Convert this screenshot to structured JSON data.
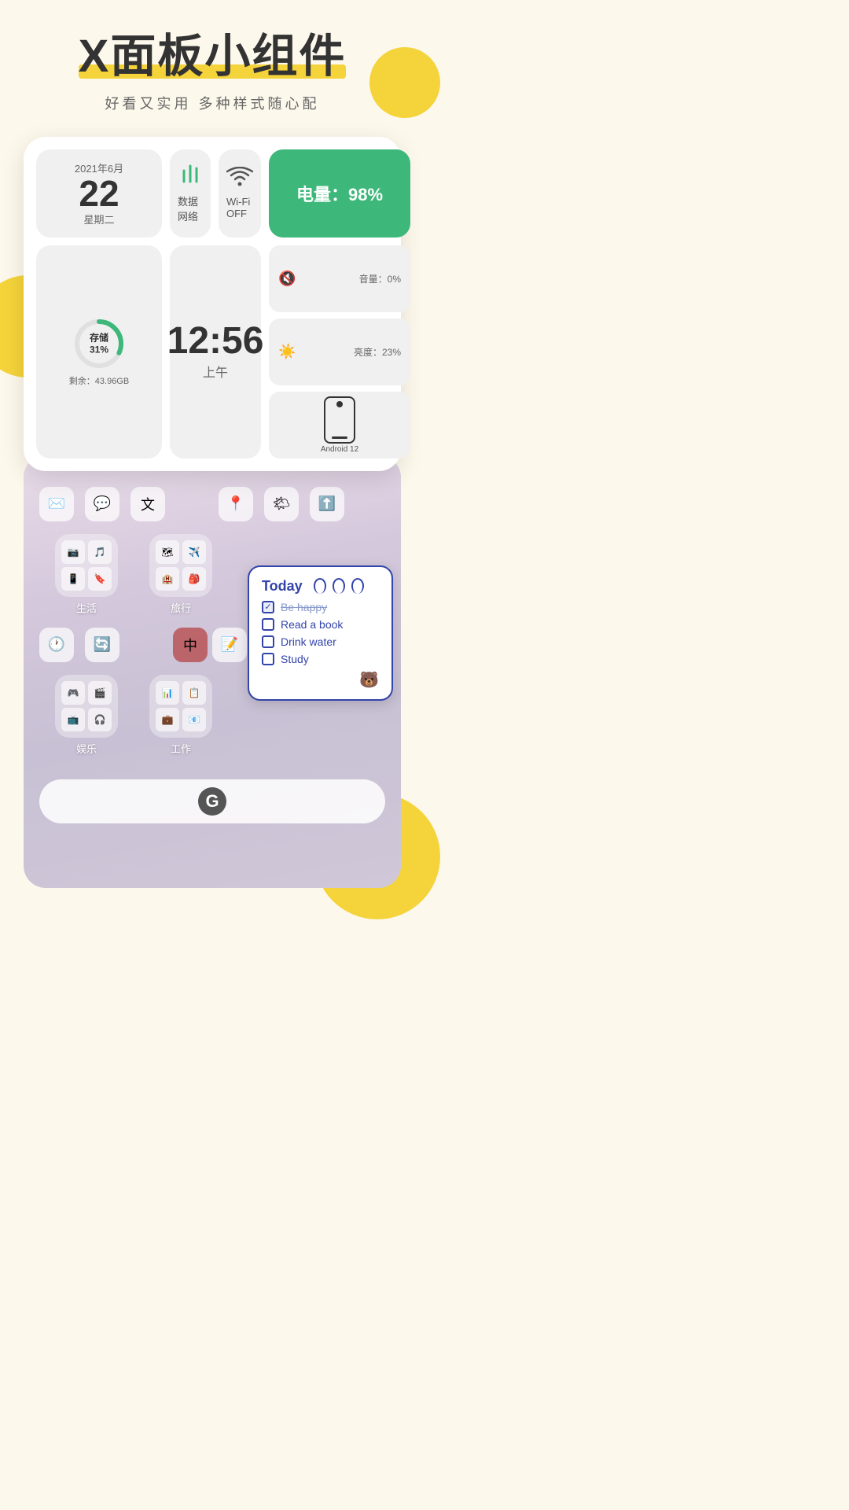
{
  "header": {
    "title": "X面板小组件",
    "subtitle": "好看又实用  多种样式随心配"
  },
  "widget": {
    "date": {
      "year_month": "2021年6月",
      "day": "22",
      "weekday": "星期二"
    },
    "network": {
      "label": "数据网络"
    },
    "wifi": {
      "label": "Wi-Fi OFF"
    },
    "battery": {
      "text": "电量：98%"
    },
    "storage": {
      "label": "存储",
      "percent": "31%",
      "remaining": "剩余：43.96GB"
    },
    "clock": {
      "time": "12:56",
      "ampm": "上午"
    },
    "volume": {
      "label": "音量：0%"
    },
    "brightness": {
      "label": "亮度：23%"
    },
    "phone_model": {
      "label": "Android 12"
    }
  },
  "phone_ui": {
    "folders": [
      {
        "label": "生活"
      },
      {
        "label": "旅行"
      },
      {
        "label": "娱乐"
      },
      {
        "label": "工作"
      }
    ]
  },
  "today_widget": {
    "title": "Today",
    "items": [
      {
        "text": "Be happy",
        "checked": true,
        "strikethrough": true
      },
      {
        "text": "Read a book",
        "checked": false,
        "strikethrough": false
      },
      {
        "text": "Drink water",
        "checked": false,
        "strikethrough": false
      },
      {
        "text": "Study",
        "checked": false,
        "strikethrough": false
      }
    ]
  },
  "colors": {
    "accent_green": "#3db87a",
    "accent_yellow": "#f5d33a",
    "accent_blue": "#3344aa"
  }
}
